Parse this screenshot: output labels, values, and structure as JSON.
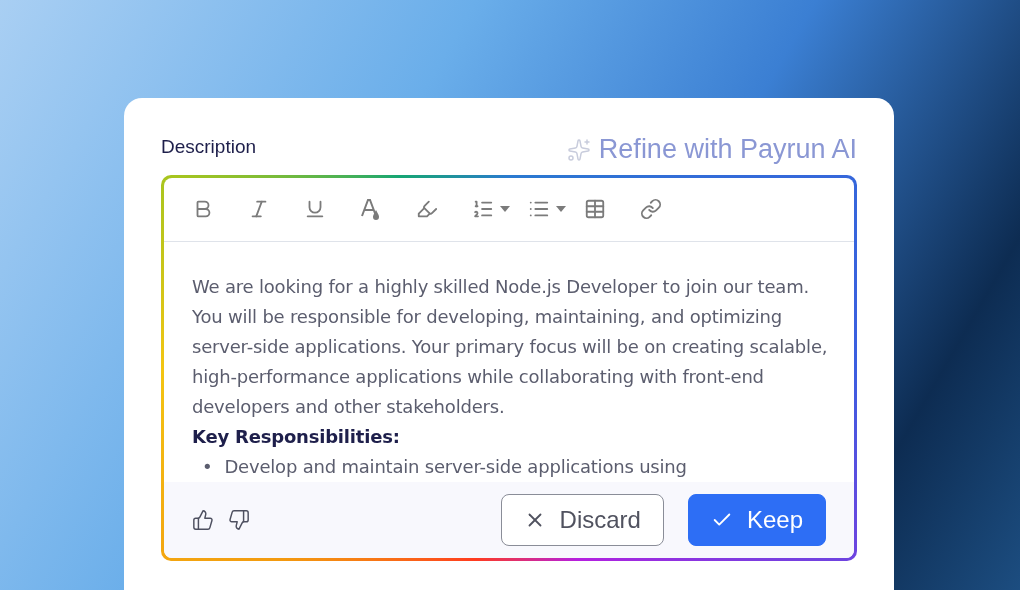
{
  "field_label": "Description",
  "ai_action": {
    "label": "Refine with Payrun AI"
  },
  "toolbar": [
    {
      "kind": "bold",
      "dropdown": false
    },
    {
      "kind": "italic",
      "dropdown": false
    },
    {
      "kind": "underline",
      "dropdown": false
    },
    {
      "kind": "text-color",
      "dropdown": false
    },
    {
      "kind": "highlight",
      "dropdown": false
    },
    {
      "kind": "ordered-list",
      "dropdown": true
    },
    {
      "kind": "bullet-list",
      "dropdown": true
    },
    {
      "kind": "table",
      "dropdown": false
    },
    {
      "kind": "link",
      "dropdown": false
    }
  ],
  "content": {
    "paragraph": "We are looking for a highly skilled Node.js Developer to join our team. You will be responsible for developing, maintaining, and optimizing server-side applications. Your primary focus will be on creating scalable, high-performance applications while collaborating with front-end developers and other stakeholders.",
    "heading": "Key Responsibilities:",
    "bullets": [
      {
        "marker": "•",
        "text": "Develop and maintain server-side applications using"
      }
    ]
  },
  "actions": [
    {
      "kind": "discard",
      "label": "Discard"
    },
    {
      "kind": "keep",
      "label": "Keep"
    }
  ]
}
